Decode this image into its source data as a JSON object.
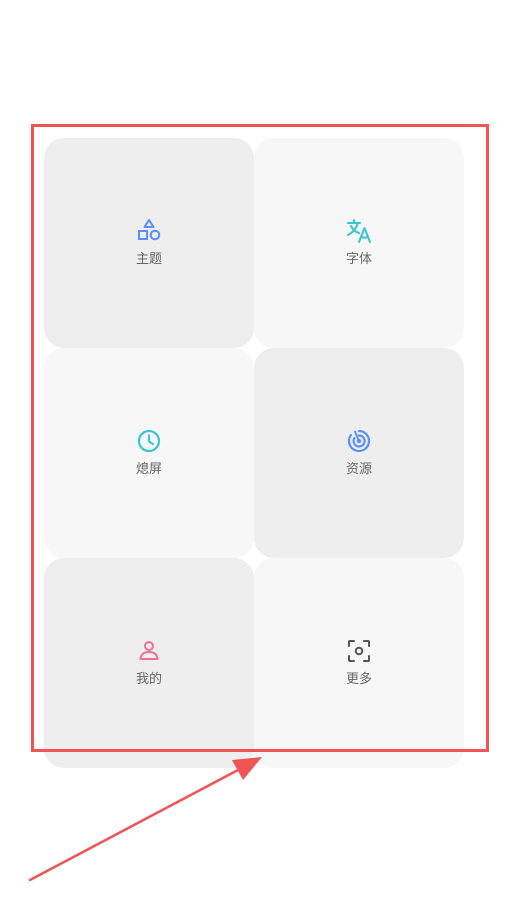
{
  "grid": {
    "tiles": [
      {
        "id": "theme",
        "label": "主题",
        "icon": "shapes-icon",
        "color": "#5b8ff9"
      },
      {
        "id": "font",
        "label": "字体",
        "icon": "translate-icon",
        "color": "#36c6d3"
      },
      {
        "id": "screen-off",
        "label": "熄屏",
        "icon": "clock-icon",
        "color": "#36c6d3"
      },
      {
        "id": "resources",
        "label": "资源",
        "icon": "radar-icon",
        "color": "#5b8ff9"
      },
      {
        "id": "mine",
        "label": "我的",
        "icon": "person-icon",
        "color": "#f0709a"
      },
      {
        "id": "more",
        "label": "更多",
        "icon": "scan-icon",
        "color": "#555555"
      }
    ]
  },
  "annotation": {
    "box_color": "#f05454",
    "arrow_color": "#f05454"
  }
}
